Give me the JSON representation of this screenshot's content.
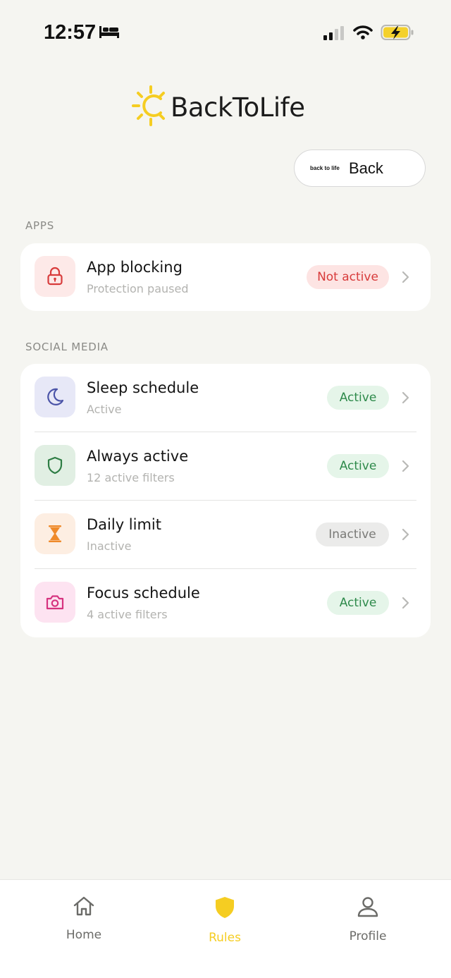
{
  "status_bar": {
    "time": "12:57",
    "icons": [
      "bed-icon",
      "cellular-signal-icon",
      "wifi-icon",
      "battery-charging-icon"
    ]
  },
  "header": {
    "logo_text": "BackToLife",
    "back_button": {
      "mini_logo": "back to life",
      "label": "Back"
    }
  },
  "colors": {
    "background": "#f5f5f1",
    "accent_yellow": "#f5cd22",
    "active_green": "#2e8a4b",
    "inactive_gray": "#7a7a77",
    "not_active_red": "#d83b3b"
  },
  "sections": {
    "apps": {
      "title": "APPS",
      "items": [
        {
          "title": "App blocking",
          "subtitle": "Protection paused",
          "status": "Not active",
          "icon": "lock-icon"
        }
      ]
    },
    "social_media": {
      "title": "SOCIAL MEDIA",
      "items": [
        {
          "title": "Sleep schedule",
          "subtitle": "Active",
          "status": "Active",
          "icon": "moon-icon"
        },
        {
          "title": "Always active",
          "subtitle": "12 active filters",
          "status": "Active",
          "icon": "shield-icon"
        },
        {
          "title": "Daily limit",
          "subtitle": "Inactive",
          "status": "Inactive",
          "icon": "hourglass-icon"
        },
        {
          "title": "Focus schedule",
          "subtitle": "4 active filters",
          "status": "Active",
          "icon": "camera-icon"
        }
      ]
    }
  },
  "tab_bar": {
    "tabs": [
      {
        "label": "Home",
        "icon": "home-icon",
        "selected": false
      },
      {
        "label": "Rules",
        "icon": "shield-icon",
        "selected": true
      },
      {
        "label": "Profile",
        "icon": "person-icon",
        "selected": false
      }
    ]
  }
}
